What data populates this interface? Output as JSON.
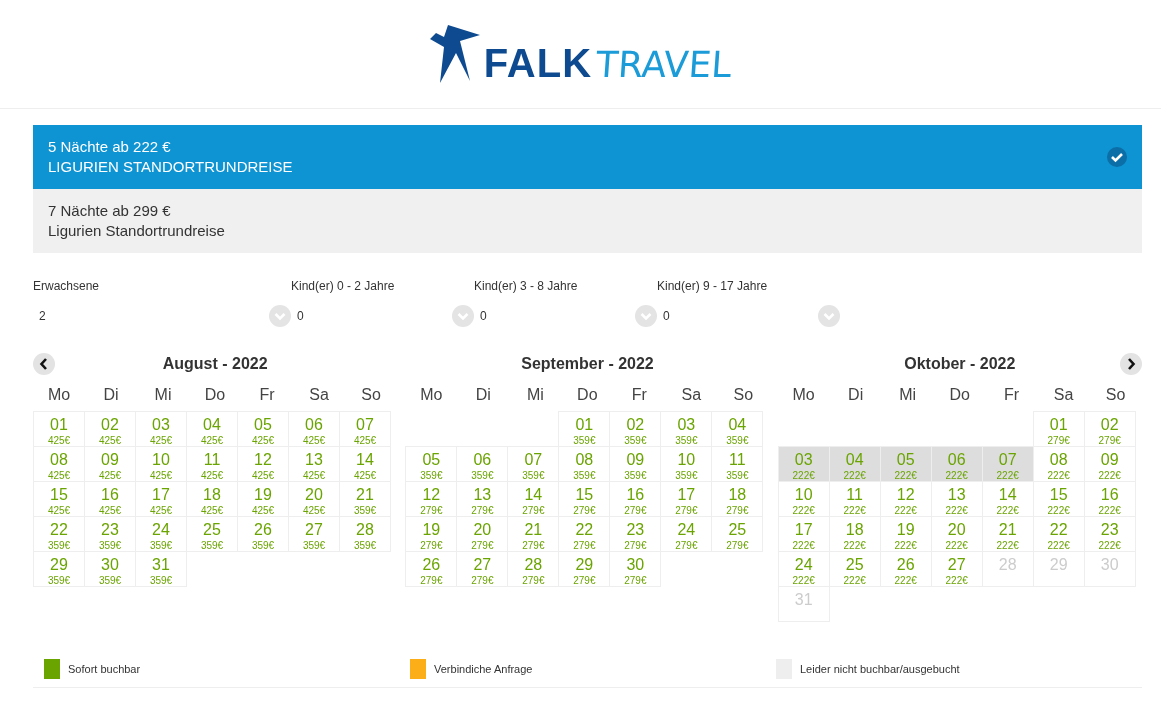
{
  "logo": {
    "brand": "FALK",
    "suffix": "TRAVEL"
  },
  "offers": [
    {
      "price_line": "5 Nächte ab 222  €",
      "name": "LIGURIEN STANDORTRUNDREISE",
      "selected": true
    },
    {
      "price_line": "7 Nächte ab 299  €",
      "name": "Ligurien Standortrundreise",
      "selected": false
    }
  ],
  "guests": [
    {
      "label": "Erwachsene",
      "value": "2"
    },
    {
      "label": "Kind(er) 0 - 2 Jahre",
      "value": "0"
    },
    {
      "label": "Kind(er) 3 - 8 Jahre",
      "value": "0"
    },
    {
      "label": "Kind(er) 9 - 17 Jahre",
      "value": "0"
    }
  ],
  "months": [
    {
      "title": "August - 2022",
      "weekdays": [
        "Mo",
        "Di",
        "Mi",
        "Do",
        "Fr",
        "Sa",
        "So"
      ],
      "weeks": [
        [
          {
            "kind": "day",
            "day": "01",
            "price": "425€",
            "available": true,
            "selected": false
          },
          {
            "kind": "day",
            "day": "02",
            "price": "425€",
            "available": true,
            "selected": false
          },
          {
            "kind": "day",
            "day": "03",
            "price": "425€",
            "available": true,
            "selected": false
          },
          {
            "kind": "day",
            "day": "04",
            "price": "425€",
            "available": true,
            "selected": false
          },
          {
            "kind": "day",
            "day": "05",
            "price": "425€",
            "available": true,
            "selected": false
          },
          {
            "kind": "day",
            "day": "06",
            "price": "425€",
            "available": true,
            "selected": false
          },
          {
            "kind": "day",
            "day": "07",
            "price": "425€",
            "available": true,
            "selected": false
          }
        ],
        [
          {
            "kind": "day",
            "day": "08",
            "price": "425€",
            "available": true,
            "selected": false
          },
          {
            "kind": "day",
            "day": "09",
            "price": "425€",
            "available": true,
            "selected": false
          },
          {
            "kind": "day",
            "day": "10",
            "price": "425€",
            "available": true,
            "selected": false
          },
          {
            "kind": "day",
            "day": "11",
            "price": "425€",
            "available": true,
            "selected": false
          },
          {
            "kind": "day",
            "day": "12",
            "price": "425€",
            "available": true,
            "selected": false
          },
          {
            "kind": "day",
            "day": "13",
            "price": "425€",
            "available": true,
            "selected": false
          },
          {
            "kind": "day",
            "day": "14",
            "price": "425€",
            "available": true,
            "selected": false
          }
        ],
        [
          {
            "kind": "day",
            "day": "15",
            "price": "425€",
            "available": true,
            "selected": false
          },
          {
            "kind": "day",
            "day": "16",
            "price": "425€",
            "available": true,
            "selected": false
          },
          {
            "kind": "day",
            "day": "17",
            "price": "425€",
            "available": true,
            "selected": false
          },
          {
            "kind": "day",
            "day": "18",
            "price": "425€",
            "available": true,
            "selected": false
          },
          {
            "kind": "day",
            "day": "19",
            "price": "425€",
            "available": true,
            "selected": false
          },
          {
            "kind": "day",
            "day": "20",
            "price": "425€",
            "available": true,
            "selected": false
          },
          {
            "kind": "day",
            "day": "21",
            "price": "359€",
            "available": true,
            "selected": false
          }
        ],
        [
          {
            "kind": "day",
            "day": "22",
            "price": "359€",
            "available": true,
            "selected": false
          },
          {
            "kind": "day",
            "day": "23",
            "price": "359€",
            "available": true,
            "selected": false
          },
          {
            "kind": "day",
            "day": "24",
            "price": "359€",
            "available": true,
            "selected": false
          },
          {
            "kind": "day",
            "day": "25",
            "price": "359€",
            "available": true,
            "selected": false
          },
          {
            "kind": "day",
            "day": "26",
            "price": "359€",
            "available": true,
            "selected": false
          },
          {
            "kind": "day",
            "day": "27",
            "price": "359€",
            "available": true,
            "selected": false
          },
          {
            "kind": "day",
            "day": "28",
            "price": "359€",
            "available": true,
            "selected": false
          }
        ],
        [
          {
            "kind": "day",
            "day": "29",
            "price": "359€",
            "available": true,
            "selected": false
          },
          {
            "kind": "day",
            "day": "30",
            "price": "359€",
            "available": true,
            "selected": false
          },
          {
            "kind": "day",
            "day": "31",
            "price": "359€",
            "available": true,
            "selected": false
          },
          {
            "kind": "blank"
          },
          {
            "kind": "blank"
          },
          {
            "kind": "blank"
          },
          {
            "kind": "blank"
          }
        ]
      ]
    },
    {
      "title": "September - 2022",
      "weekdays": [
        "Mo",
        "Di",
        "Mi",
        "Do",
        "Fr",
        "Sa",
        "So"
      ],
      "weeks": [
        [
          {
            "kind": "blank"
          },
          {
            "kind": "blank"
          },
          {
            "kind": "blank"
          },
          {
            "kind": "day",
            "day": "01",
            "price": "359€",
            "available": true,
            "selected": false
          },
          {
            "kind": "day",
            "day": "02",
            "price": "359€",
            "available": true,
            "selected": false
          },
          {
            "kind": "day",
            "day": "03",
            "price": "359€",
            "available": true,
            "selected": false
          },
          {
            "kind": "day",
            "day": "04",
            "price": "359€",
            "available": true,
            "selected": false
          }
        ],
        [
          {
            "kind": "day",
            "day": "05",
            "price": "359€",
            "available": true,
            "selected": false
          },
          {
            "kind": "day",
            "day": "06",
            "price": "359€",
            "available": true,
            "selected": false
          },
          {
            "kind": "day",
            "day": "07",
            "price": "359€",
            "available": true,
            "selected": false
          },
          {
            "kind": "day",
            "day": "08",
            "price": "359€",
            "available": true,
            "selected": false
          },
          {
            "kind": "day",
            "day": "09",
            "price": "359€",
            "available": true,
            "selected": false
          },
          {
            "kind": "day",
            "day": "10",
            "price": "359€",
            "available": true,
            "selected": false
          },
          {
            "kind": "day",
            "day": "11",
            "price": "359€",
            "available": true,
            "selected": false
          }
        ],
        [
          {
            "kind": "day",
            "day": "12",
            "price": "279€",
            "available": true,
            "selected": false
          },
          {
            "kind": "day",
            "day": "13",
            "price": "279€",
            "available": true,
            "selected": false
          },
          {
            "kind": "day",
            "day": "14",
            "price": "279€",
            "available": true,
            "selected": false
          },
          {
            "kind": "day",
            "day": "15",
            "price": "279€",
            "available": true,
            "selected": false
          },
          {
            "kind": "day",
            "day": "16",
            "price": "279€",
            "available": true,
            "selected": false
          },
          {
            "kind": "day",
            "day": "17",
            "price": "279€",
            "available": true,
            "selected": false
          },
          {
            "kind": "day",
            "day": "18",
            "price": "279€",
            "available": true,
            "selected": false
          }
        ],
        [
          {
            "kind": "day",
            "day": "19",
            "price": "279€",
            "available": true,
            "selected": false
          },
          {
            "kind": "day",
            "day": "20",
            "price": "279€",
            "available": true,
            "selected": false
          },
          {
            "kind": "day",
            "day": "21",
            "price": "279€",
            "available": true,
            "selected": false
          },
          {
            "kind": "day",
            "day": "22",
            "price": "279€",
            "available": true,
            "selected": false
          },
          {
            "kind": "day",
            "day": "23",
            "price": "279€",
            "available": true,
            "selected": false
          },
          {
            "kind": "day",
            "day": "24",
            "price": "279€",
            "available": true,
            "selected": false
          },
          {
            "kind": "day",
            "day": "25",
            "price": "279€",
            "available": true,
            "selected": false
          }
        ],
        [
          {
            "kind": "day",
            "day": "26",
            "price": "279€",
            "available": true,
            "selected": false
          },
          {
            "kind": "day",
            "day": "27",
            "price": "279€",
            "available": true,
            "selected": false
          },
          {
            "kind": "day",
            "day": "28",
            "price": "279€",
            "available": true,
            "selected": false
          },
          {
            "kind": "day",
            "day": "29",
            "price": "279€",
            "available": true,
            "selected": false
          },
          {
            "kind": "day",
            "day": "30",
            "price": "279€",
            "available": true,
            "selected": false
          },
          {
            "kind": "blank"
          },
          {
            "kind": "blank"
          }
        ]
      ]
    },
    {
      "title": "Oktober - 2022",
      "weekdays": [
        "Mo",
        "Di",
        "Mi",
        "Do",
        "Fr",
        "Sa",
        "So"
      ],
      "weeks": [
        [
          {
            "kind": "blank"
          },
          {
            "kind": "blank"
          },
          {
            "kind": "blank"
          },
          {
            "kind": "blank"
          },
          {
            "kind": "blank"
          },
          {
            "kind": "day",
            "day": "01",
            "price": "279€",
            "available": true,
            "selected": false
          },
          {
            "kind": "day",
            "day": "02",
            "price": "279€",
            "available": true,
            "selected": false
          }
        ],
        [
          {
            "kind": "day",
            "day": "03",
            "price": "222€",
            "available": true,
            "selected": true
          },
          {
            "kind": "day",
            "day": "04",
            "price": "222€",
            "available": true,
            "selected": true
          },
          {
            "kind": "day",
            "day": "05",
            "price": "222€",
            "available": true,
            "selected": true
          },
          {
            "kind": "day",
            "day": "06",
            "price": "222€",
            "available": true,
            "selected": true
          },
          {
            "kind": "day",
            "day": "07",
            "price": "222€",
            "available": true,
            "selected": true
          },
          {
            "kind": "day",
            "day": "08",
            "price": "222€",
            "available": true,
            "selected": false
          },
          {
            "kind": "day",
            "day": "09",
            "price": "222€",
            "available": true,
            "selected": false
          }
        ],
        [
          {
            "kind": "day",
            "day": "10",
            "price": "222€",
            "available": true,
            "selected": false
          },
          {
            "kind": "day",
            "day": "11",
            "price": "222€",
            "available": true,
            "selected": false
          },
          {
            "kind": "day",
            "day": "12",
            "price": "222€",
            "available": true,
            "selected": false
          },
          {
            "kind": "day",
            "day": "13",
            "price": "222€",
            "available": true,
            "selected": false
          },
          {
            "kind": "day",
            "day": "14",
            "price": "222€",
            "available": true,
            "selected": false
          },
          {
            "kind": "day",
            "day": "15",
            "price": "222€",
            "available": true,
            "selected": false
          },
          {
            "kind": "day",
            "day": "16",
            "price": "222€",
            "available": true,
            "selected": false
          }
        ],
        [
          {
            "kind": "day",
            "day": "17",
            "price": "222€",
            "available": true,
            "selected": false
          },
          {
            "kind": "day",
            "day": "18",
            "price": "222€",
            "available": true,
            "selected": false
          },
          {
            "kind": "day",
            "day": "19",
            "price": "222€",
            "available": true,
            "selected": false
          },
          {
            "kind": "day",
            "day": "20",
            "price": "222€",
            "available": true,
            "selected": false
          },
          {
            "kind": "day",
            "day": "21",
            "price": "222€",
            "available": true,
            "selected": false
          },
          {
            "kind": "day",
            "day": "22",
            "price": "222€",
            "available": true,
            "selected": false
          },
          {
            "kind": "day",
            "day": "23",
            "price": "222€",
            "available": true,
            "selected": false
          }
        ],
        [
          {
            "kind": "day",
            "day": "24",
            "price": "222€",
            "available": true,
            "selected": false
          },
          {
            "kind": "day",
            "day": "25",
            "price": "222€",
            "available": true,
            "selected": false
          },
          {
            "kind": "day",
            "day": "26",
            "price": "222€",
            "available": true,
            "selected": false
          },
          {
            "kind": "day",
            "day": "27",
            "price": "222€",
            "available": true,
            "selected": false
          },
          {
            "kind": "day",
            "day": "28",
            "available": false,
            "selected": false
          },
          {
            "kind": "day",
            "day": "29",
            "available": false,
            "selected": false
          },
          {
            "kind": "day",
            "day": "30",
            "available": false,
            "selected": false
          }
        ],
        [
          {
            "kind": "day",
            "day": "31",
            "available": false,
            "selected": false
          },
          {
            "kind": "blank"
          },
          {
            "kind": "blank"
          },
          {
            "kind": "blank"
          },
          {
            "kind": "blank"
          },
          {
            "kind": "blank"
          },
          {
            "kind": "blank"
          }
        ]
      ]
    }
  ],
  "legend": [
    {
      "label": "Sofort buchbar",
      "color": "#6aa400"
    },
    {
      "label": "Verbindiche Anfrage",
      "color": "#fbae17"
    },
    {
      "label": "Leider nicht buchbar/ausgebucht",
      "color": "#eeeeee"
    }
  ]
}
